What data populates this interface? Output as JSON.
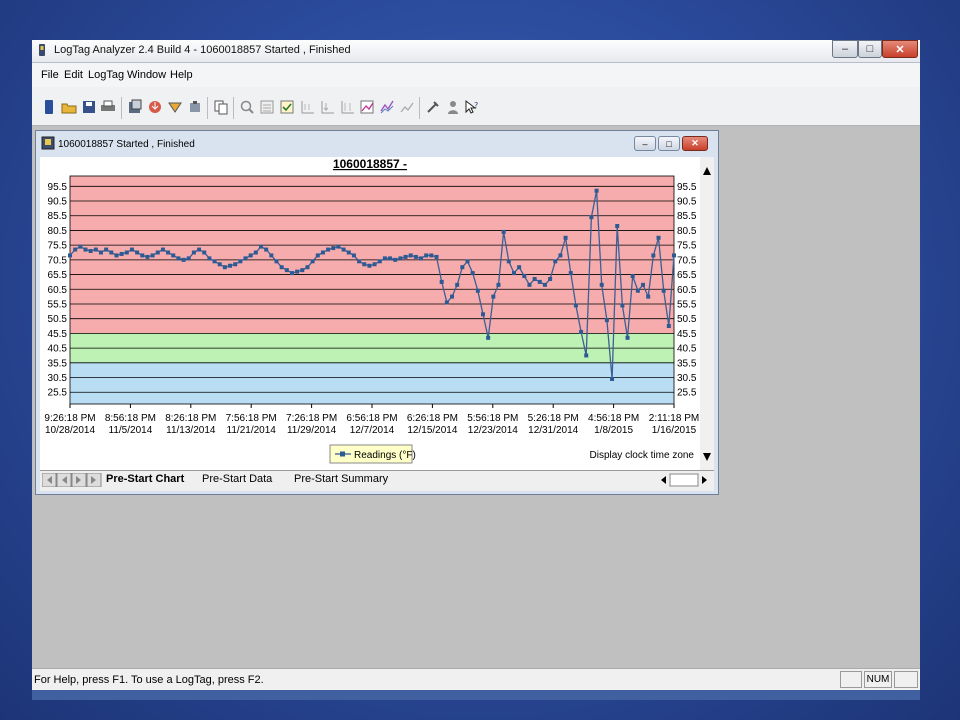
{
  "window": {
    "title": "LogTag Analyzer 2.4 Build 4 - 1060018857 Started , Finished",
    "minimize_label": "–",
    "maximize_label": "□",
    "close_label": "✕"
  },
  "menu": [
    {
      "label": "File"
    },
    {
      "label": "Edit"
    },
    {
      "label": "LogTag"
    },
    {
      "label": "Window"
    },
    {
      "label": "Help"
    }
  ],
  "toolbar": {
    "icons": [
      "new-file-icon",
      "open-folder-icon",
      "save-icon",
      "print-icon",
      "configure-icon",
      "download-icon",
      "options-icon",
      "hardware-icon",
      "copy-icon",
      "zoom-icon",
      "chart-view-icon",
      "check-icon",
      "axis-icon",
      "axis-alt-icon",
      "scale-icon",
      "grid-chart-icon",
      "multi-series-icon",
      "line-chart-icon",
      "tools-icon",
      "user-icon",
      "help-pointer-icon"
    ]
  },
  "child_window": {
    "title": "1060018857 Started , Finished",
    "minimize_label": "–",
    "maximize_label": "□",
    "close_label": "✕"
  },
  "chart_data": {
    "type": "line",
    "title": "1060018857 -",
    "ylim": [
      21.5,
      99
    ],
    "y_ticks": [
      "95.5",
      "90.5",
      "85.5",
      "80.5",
      "75.5",
      "70.5",
      "65.5",
      "60.5",
      "55.5",
      "50.5",
      "45.5",
      "40.5",
      "35.5",
      "30.5",
      "25.5"
    ],
    "x_ticks": [
      {
        "time": "9:26:18 PM",
        "date": "10/28/2014"
      },
      {
        "time": "8:56:18 PM",
        "date": "11/5/2014"
      },
      {
        "time": "8:26:18 PM",
        "date": "11/13/2014"
      },
      {
        "time": "7:56:18 PM",
        "date": "11/21/2014"
      },
      {
        "time": "7:26:18 PM",
        "date": "11/29/2014"
      },
      {
        "time": "6:56:18 PM",
        "date": "12/7/2014"
      },
      {
        "time": "6:26:18 PM",
        "date": "12/15/2014"
      },
      {
        "time": "5:56:18 PM",
        "date": "12/23/2014"
      },
      {
        "time": "5:26:18 PM",
        "date": "12/31/2014"
      },
      {
        "time": "4:56:18 PM",
        "date": "1/8/2015"
      },
      {
        "time": "2:11:18 PM",
        "date": "1/16/2015"
      }
    ],
    "bands": [
      {
        "from": 45.5,
        "to": 99,
        "color": "#f6acac"
      },
      {
        "from": 35.5,
        "to": 45.5,
        "color": "#bef2b4"
      },
      {
        "from": 21.5,
        "to": 35.5,
        "color": "#b9def3"
      }
    ],
    "series": [
      {
        "name": "Readings (°F)",
        "color": "#2e5a94",
        "values": [
          72,
          74,
          75,
          74,
          73.5,
          74,
          73,
          74,
          73,
          72,
          72.5,
          73,
          74,
          73,
          72,
          71.5,
          72,
          73,
          74,
          73,
          72,
          71,
          70.5,
          71,
          73,
          74,
          73,
          71,
          70,
          69,
          68,
          68.5,
          69,
          70,
          71,
          72,
          73,
          75,
          74,
          72,
          70,
          68,
          67,
          66,
          66.5,
          67,
          68,
          70,
          72,
          73,
          74,
          74.5,
          75,
          74,
          73,
          72,
          70,
          69,
          68.5,
          69,
          70,
          71,
          71,
          70.5,
          71,
          71.5,
          72,
          71.5,
          71,
          72,
          72,
          71.5,
          63,
          56,
          58,
          62,
          68,
          70,
          66,
          60,
          52,
          44,
          58,
          62,
          80,
          70,
          66,
          68,
          65,
          62,
          64,
          63,
          62,
          64,
          70,
          72,
          78,
          66,
          55,
          46,
          38,
          85,
          94,
          62,
          50,
          30,
          82,
          55,
          44,
          65,
          60,
          62,
          58,
          72,
          78,
          60,
          48,
          72
        ]
      }
    ],
    "legend": "Readings (°F)",
    "footnote": "Display clock time zone"
  },
  "tabs": [
    {
      "label": "Pre-Start Chart",
      "active": true
    },
    {
      "label": "Pre-Start Data"
    },
    {
      "label": "Pre-Start Summary"
    }
  ],
  "status": {
    "text": "For Help, press F1. To use a LogTag, press F2.",
    "num": "NUM"
  }
}
